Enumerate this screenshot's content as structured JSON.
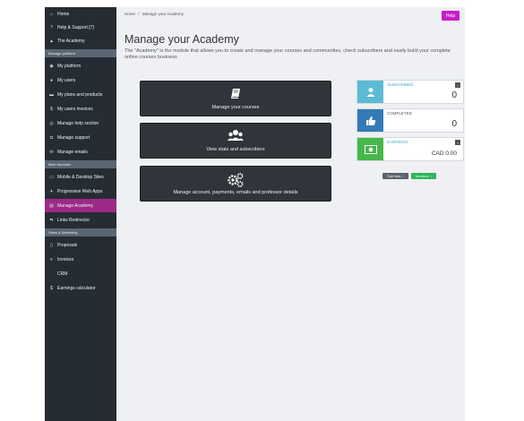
{
  "sidebar": {
    "items": [
      {
        "label": "Home",
        "icon": "home-icon",
        "glyph": "⌂"
      },
      {
        "label": "Help & Support [7]",
        "icon": "question-icon",
        "glyph": "?"
      },
      {
        "label": "The Academy",
        "icon": "graduation-cap-icon",
        "glyph": "▲"
      },
      {
        "label": "My platform",
        "icon": "dashboard-icon",
        "glyph": "◉"
      },
      {
        "label": "My users",
        "icon": "users-icon",
        "glyph": "●"
      },
      {
        "label": "My plans and products",
        "icon": "cart-icon",
        "glyph": "▬"
      },
      {
        "label": "My users invoices",
        "icon": "dollar-icon",
        "glyph": "$"
      },
      {
        "label": "Manage help section",
        "icon": "lifebuoy-icon",
        "glyph": "◎"
      },
      {
        "label": "Manage support",
        "icon": "support-icon",
        "glyph": "◘"
      },
      {
        "label": "Manage emails",
        "icon": "envelope-icon",
        "glyph": "✉"
      },
      {
        "label": "Mobile & Desktop Sites",
        "icon": "monitor-icon",
        "glyph": "▭"
      },
      {
        "label": "Progressive Web Apps",
        "icon": "rocket-icon",
        "glyph": "✈"
      },
      {
        "label": "Manage Academy",
        "icon": "academy-icon",
        "glyph": "▤"
      },
      {
        "label": "Links Redirector",
        "icon": "link-icon",
        "glyph": "⇆"
      },
      {
        "label": "Proposals",
        "icon": "file-icon",
        "glyph": "▯"
      },
      {
        "label": "Invoices",
        "icon": "invoice-icon",
        "glyph": "≡"
      },
      {
        "label": "CRM",
        "icon": "crm-icon",
        "glyph": ""
      },
      {
        "label": "Earnings calculator",
        "icon": "dollar-icon",
        "glyph": "$"
      }
    ],
    "sections": [
      "Manage platform",
      "Main Modules",
      "Sales & Marketing"
    ]
  },
  "breadcrumb": {
    "home": "Home",
    "separator": "/",
    "current": "Manage your Academy"
  },
  "help_button": "Help",
  "page": {
    "title": "Manage your Academy",
    "description": "The \"Academy\" is the module that allows you to create and manage your courses and communities, check subscribers and easily build your complete online courses business"
  },
  "actions": [
    {
      "label": "Manage your courses",
      "icon": "book-icon"
    },
    {
      "label": "View stats and subscribers",
      "icon": "users-group-icon"
    },
    {
      "label": "Manage account, payments, emails and professor details",
      "icon": "gears-icon"
    }
  ],
  "stats": [
    {
      "label": "SUBSCRIBED",
      "value": "0",
      "icon": "user-icon",
      "color": "#5bbbd4",
      "label_color": "#4aa6c4"
    },
    {
      "label": "COMPLETED",
      "value": "0",
      "icon": "thumbs-up-icon",
      "color": "#337ab7",
      "label_color": "#555555"
    },
    {
      "label": "EARNINGS",
      "value": "CAD 0.00",
      "icon": "money-icon",
      "color": "#45b74b",
      "label_color": "#4aa6c4"
    }
  ],
  "stat_arrow_glyph": "›",
  "buttons": {
    "subscribers": "Sub lists",
    "invoices": "Invoices",
    "arrow_glyph": "›"
  },
  "colors": {
    "accent": "#9c2a86",
    "sidebar": "#262c33",
    "help": "#c51fc5",
    "invoices": "#2db55d"
  }
}
